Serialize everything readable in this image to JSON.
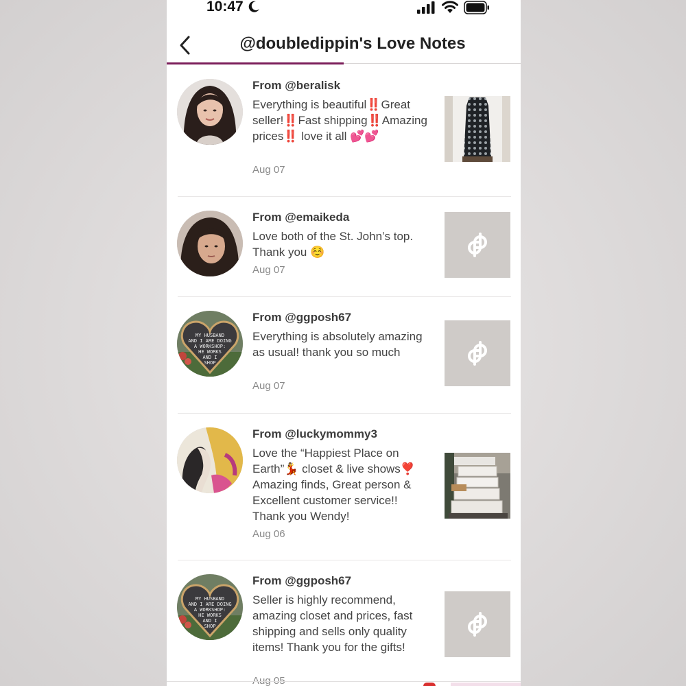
{
  "status": {
    "time": "10:47"
  },
  "header": {
    "title": "@doubledippin's Love Notes"
  },
  "notes": [
    {
      "from": "From @beralisk",
      "message": "Everything is beautiful‼️Great seller!‼️Fast shipping‼️Amazing prices‼️ love it all 💕💕",
      "date": "Aug 07",
      "thumbnail": "dress-photo"
    },
    {
      "from": "From @emaikeda",
      "message": "Love both of the St. John’s top. Thank you ☺️",
      "date": "Aug 07",
      "thumbnail": "placeholder"
    },
    {
      "from": "From @ggposh67",
      "message": "Everything is absolutely amazing as usual! thank you so much",
      "date": "Aug 07",
      "thumbnail": "placeholder"
    },
    {
      "from": "From @luckymommy3",
      "message": "Love the “Happiest Place on Earth”💃 closet & live shows❣️Amazing finds, Great person & Excellent customer service!! Thank you Wendy!",
      "date": "Aug 06",
      "thumbnail": "packages-photo"
    },
    {
      "from": "From @ggposh67",
      "message": "Seller is highly recommend, amazing closet and prices, fast shipping and sells only quality items! Thank you for the gifts!",
      "date": "Aug 05",
      "thumbnail": "placeholder"
    }
  ],
  "colors": {
    "accent": "#7b1d5a",
    "placeholder_bg": "#cfcbc8",
    "date_text": "#8a8a8a"
  },
  "heart_sign": {
    "text": "MY HUSBAND AND I ARE DOING A WORKSHOP: HE WORKS AND I SHOP"
  }
}
